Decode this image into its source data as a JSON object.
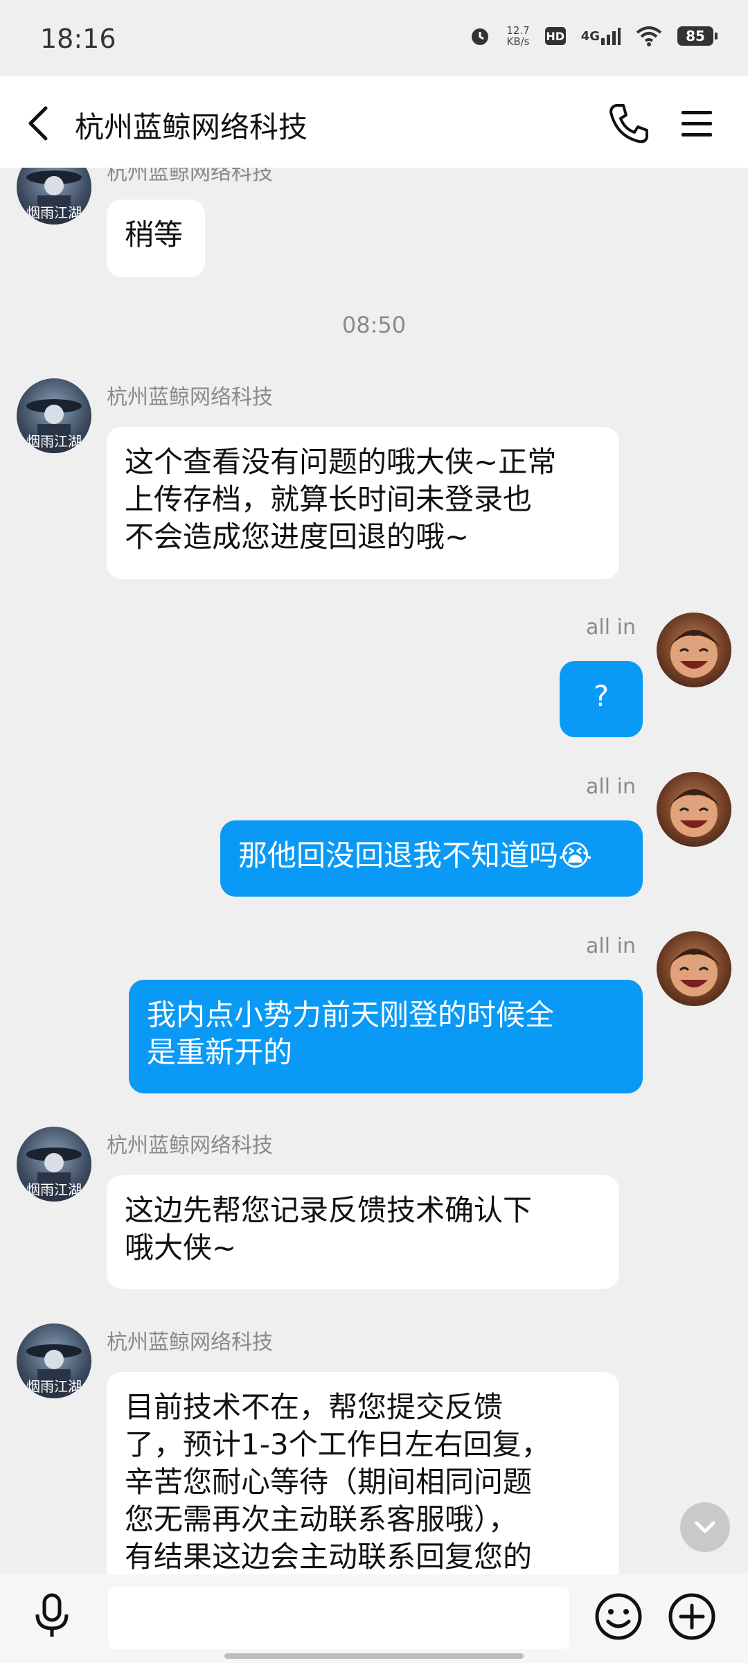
{
  "status_bar": {
    "time": "18:16",
    "net_speed_value": "12.7",
    "net_speed_unit": "KB/s",
    "hd_badge": "HD",
    "network": "4G",
    "battery": "85"
  },
  "header": {
    "title": "杭州蓝鲸网络科技",
    "icons": [
      "back-arrow-icon",
      "phone-icon",
      "menu-icon"
    ]
  },
  "chat": {
    "top_partial_sender": "杭州蓝鲸网络科技",
    "messages": [
      {
        "side": "in",
        "text": "稍等"
      },
      {
        "type": "timestamp",
        "text": "08:50"
      },
      {
        "side": "in",
        "sender": "杭州蓝鲸网络科技",
        "lines": [
          "这个查看没有问题的哦大侠~正常",
          "上传存档，就算长时间未登录也",
          "不会造成您进度回退的哦~"
        ]
      },
      {
        "side": "out",
        "sender": "all  in",
        "text": "?"
      },
      {
        "side": "out",
        "sender": "all  in",
        "text": "那他回没回退我不知道吗😭"
      },
      {
        "side": "out",
        "sender": "all  in",
        "lines": [
          "我内点小势力前天刚登的时候全",
          "是重新开的"
        ]
      },
      {
        "side": "in",
        "sender": "杭州蓝鲸网络科技",
        "lines": [
          "这边先帮您记录反馈技术确认下",
          "哦大侠~"
        ]
      },
      {
        "side": "in",
        "sender": "杭州蓝鲸网络科技",
        "lines": [
          "目前技术不在，帮您提交反馈",
          "了，预计1-3个工作日左右回复，",
          "辛苦您耐心等待（期间相同问题",
          "您无需再次主动联系客服哦），",
          "有结果这边会主动联系回复您的"
        ]
      }
    ]
  },
  "input_bar": {
    "placeholder": "",
    "icons": [
      "microphone-icon",
      "emoji-icon",
      "plus-icon"
    ]
  },
  "colors": {
    "outgoing_bubble": "#0a9af5",
    "incoming_bubble": "#ffffff",
    "background": "#efefef"
  }
}
